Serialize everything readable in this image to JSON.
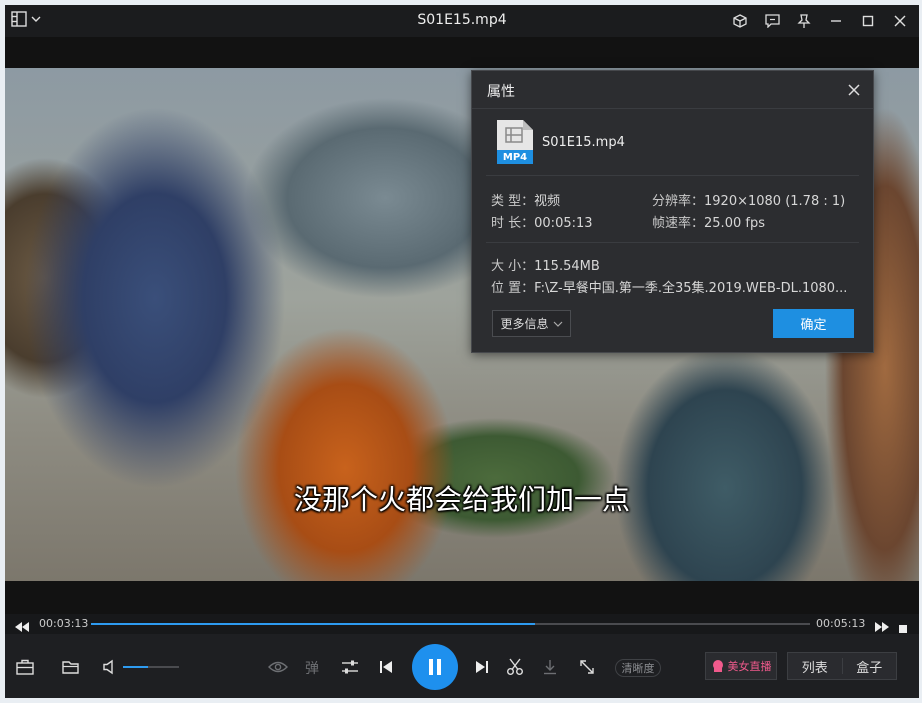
{
  "window": {
    "title": "S01E15.mp4"
  },
  "video": {
    "subtitle": "没那个火都会给我们加一点"
  },
  "dialog": {
    "title": "属性",
    "file_name": "S01E15.mp4",
    "file_badge": "MP4",
    "type_key": "类 型：",
    "type_val": "视频",
    "resolution_key": "分辨率：",
    "resolution_val": "1920×1080 (1.78 : 1)",
    "duration_key": "时 长：",
    "duration_val": "00:05:13",
    "framerate_key": "帧速率：",
    "framerate_val": "25.00 fps",
    "size_key": "大 小：",
    "size_val": "115.54MB",
    "location_key": "位 置：",
    "location_val": "F:\\Z-早餐中国.第一季.全35集.2019.WEB-DL.1080...",
    "more_label": "更多信息",
    "ok_label": "确定"
  },
  "progress": {
    "current": "00:03:13",
    "total": "00:05:13",
    "fraction": 0.617
  },
  "controls": {
    "danmaku_label": "弹",
    "clarity_label": "清晰度",
    "live_label": "美女直播",
    "list_label": "列表",
    "box_label": "盒子",
    "volume_fraction": 0.45
  },
  "colors": {
    "accent": "#1e90ee",
    "live_pink": "#f05a8c"
  }
}
